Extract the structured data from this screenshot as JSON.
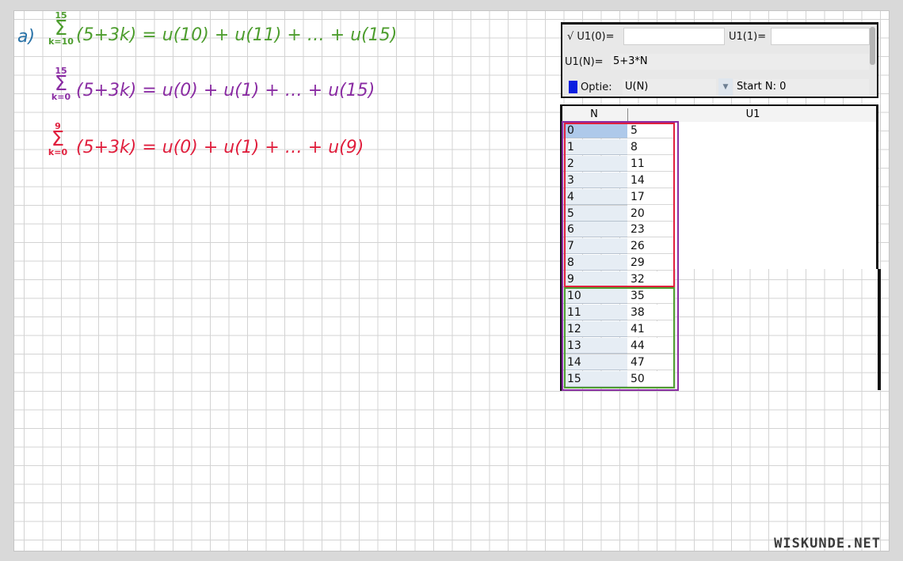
{
  "notes": {
    "label": "a",
    "line1": {
      "upper": "15",
      "lower": "k=10",
      "expr": "(5+3k) = u(10) + u(11) + … + u(15)"
    },
    "line2": {
      "upper": "15",
      "lower": "k=0",
      "expr": "(5+3k) = u(0) + u(1) + … + u(15)"
    },
    "line3": {
      "upper": "9",
      "lower": "k=0",
      "expr": "(5+3k) = u(0) + u(1) + … + u(9)"
    }
  },
  "calculator": {
    "u0_label": "√ U1(0)=",
    "u0_value": "",
    "u1_label": "U1(1)=",
    "u1_value": "",
    "formula_label": "U1(N)=",
    "formula_value": "5+3*N",
    "option_label": "Optie:",
    "option_value": "U(N)",
    "start_label": "Start N:",
    "start_value": "0"
  },
  "table": {
    "col_n": "N",
    "col_u": "U1",
    "rows": [
      {
        "n": "0",
        "u": "5"
      },
      {
        "n": "1",
        "u": "8"
      },
      {
        "n": "2",
        "u": "11"
      },
      {
        "n": "3",
        "u": "14"
      },
      {
        "n": "4",
        "u": "17"
      },
      {
        "n": "5",
        "u": "20"
      },
      {
        "n": "6",
        "u": "23"
      },
      {
        "n": "7",
        "u": "26"
      },
      {
        "n": "8",
        "u": "29"
      },
      {
        "n": "9",
        "u": "32"
      },
      {
        "n": "10",
        "u": "35"
      },
      {
        "n": "11",
        "u": "38"
      },
      {
        "n": "12",
        "u": "41"
      },
      {
        "n": "13",
        "u": "44"
      },
      {
        "n": "14",
        "u": "47"
      },
      {
        "n": "15",
        "u": "50"
      }
    ]
  },
  "watermark": "WISKUNDE.NET",
  "colors": {
    "green": "#4d9d2e",
    "purple": "#8a2ca3",
    "red": "#e01f3d",
    "blue": "#0b1fe0"
  }
}
